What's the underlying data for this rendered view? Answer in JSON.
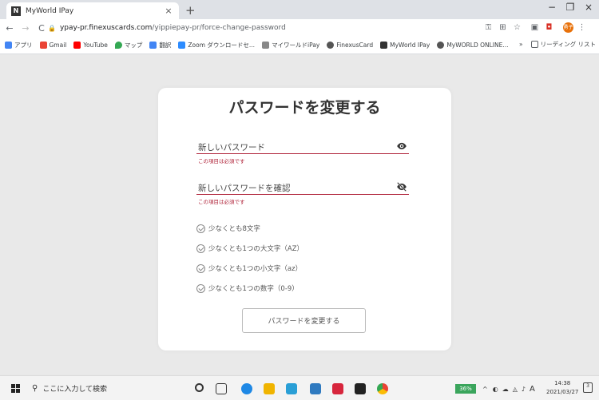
{
  "browser": {
    "tab_title": "MyWorld IPay",
    "tab_close": "×",
    "new_tab": "+",
    "window_controls": [
      "−",
      "❐",
      "×"
    ],
    "url_host": "ypay-pr.finexuscards.com",
    "url_path": "/yippiepay-pr/force-change-password",
    "profile_initial": "勇子"
  },
  "bookmarks": {
    "items": [
      {
        "label": "アプリ",
        "color": "#4285f4"
      },
      {
        "label": "Gmail",
        "color": "#ea4335"
      },
      {
        "label": "YouTube",
        "color": "#ff0000"
      },
      {
        "label": "マップ",
        "color": "#34a853"
      },
      {
        "label": "翻訳",
        "color": "#4285f4"
      },
      {
        "label": "Zoom ダウンロードセ...",
        "color": "#2d8cff"
      },
      {
        "label": "マイワールドiPay",
        "color": "#888888"
      },
      {
        "label": "FinexusCard",
        "color": "#555555"
      },
      {
        "label": "MyWorld IPay",
        "color": "#333333"
      },
      {
        "label": "MyWORLD ONLINE...",
        "color": "#555555"
      }
    ],
    "reading_list": "リーディング リスト"
  },
  "form": {
    "title": "パスワードを変更する",
    "new_password_label": "新しいパスワード",
    "new_password_error": "この項目は必須です",
    "confirm_password_label": "新しいパスワードを確認",
    "confirm_password_error": "この項目は必須です",
    "rules": [
      "少なくとも8文字",
      "少なくとも1つの大文字（AZ）",
      "少なくとも1つの小文字（az）",
      "少なくとも1つの数字（0-9）"
    ],
    "submit_label": "パスワードを変更する"
  },
  "taskbar": {
    "search_placeholder": "ここに入力して検索",
    "battery": "36%",
    "ime": "A",
    "time": "14:38",
    "date": "2021/03/27",
    "notification_count": "3"
  },
  "colors": {
    "accent_red": "#b0243a",
    "page_bg": "#e9e9e9"
  }
}
